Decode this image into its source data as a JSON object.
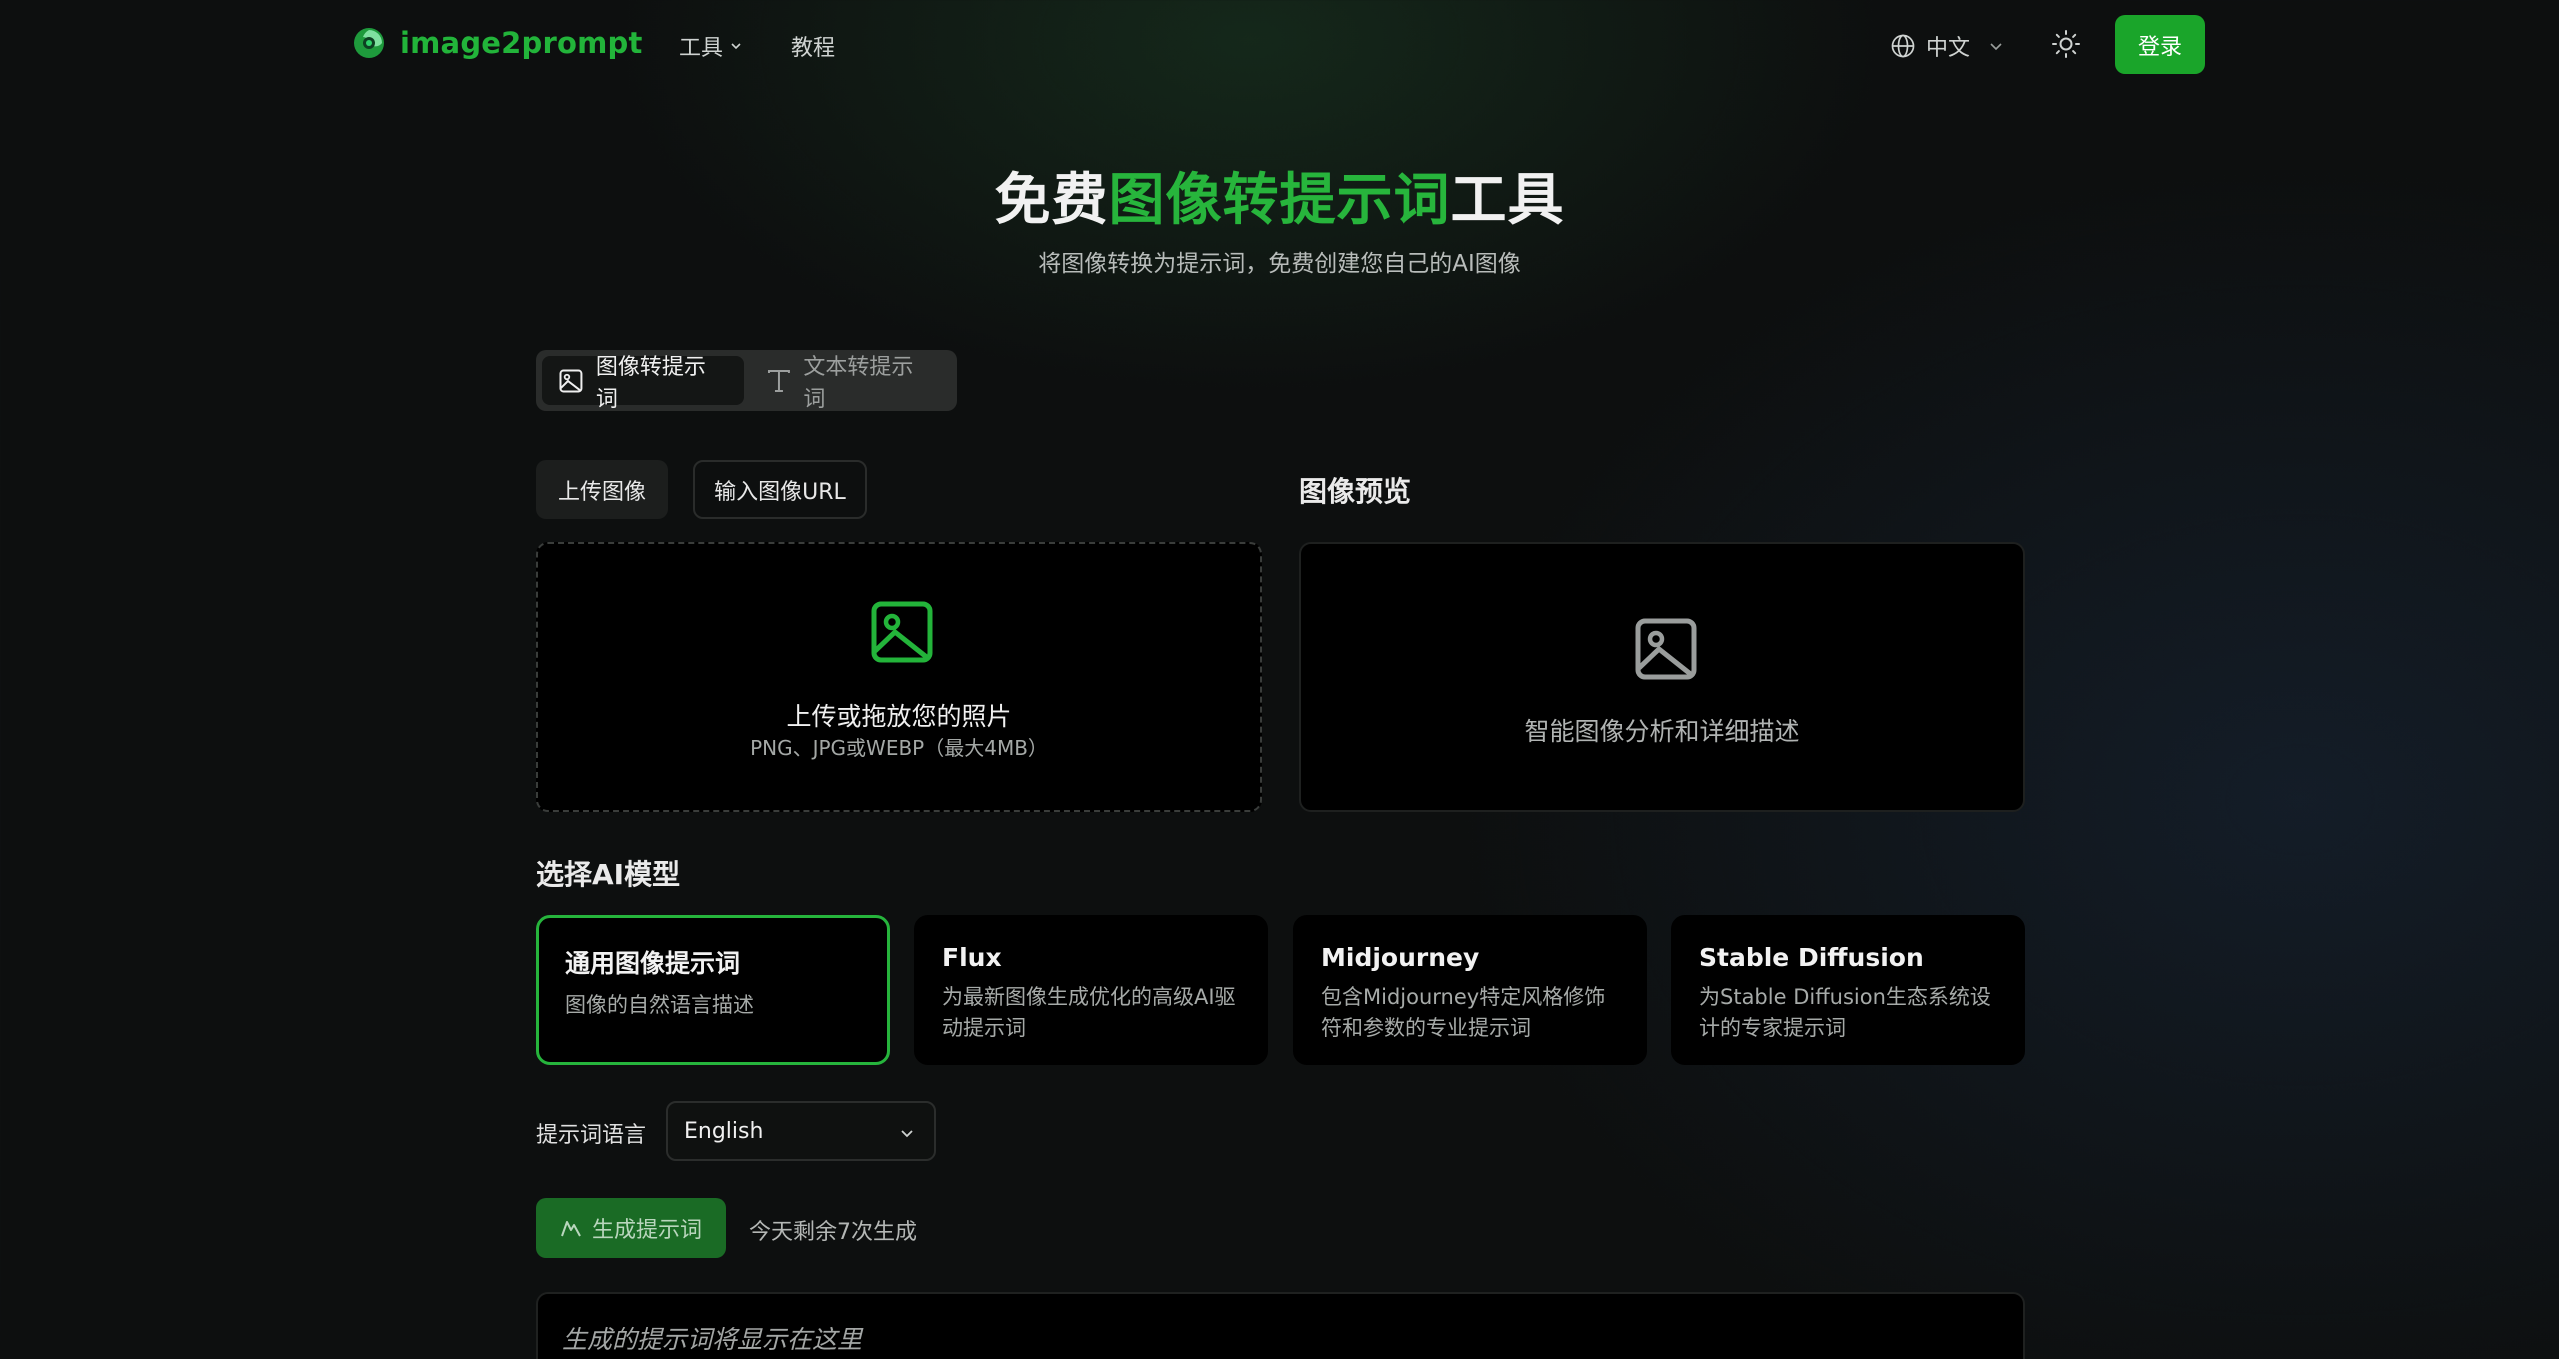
{
  "header": {
    "brand": "image2prompt",
    "nav": [
      {
        "label": "工具",
        "has_dropdown": true
      },
      {
        "label": "教程",
        "has_dropdown": false
      }
    ],
    "language": "中文",
    "theme_icon": "sun-icon",
    "login_label": "登录"
  },
  "hero": {
    "title_prefix": "免费",
    "title_accent": "图像转提示词",
    "title_suffix": "工具",
    "subtitle": "将图像转换为提示词，免费创建您自己的AI图像"
  },
  "mode_tabs": [
    {
      "label": "图像转提示词",
      "icon": "image-icon",
      "active": true
    },
    {
      "label": "文本转提示词",
      "icon": "text-icon",
      "active": false
    }
  ],
  "upload": {
    "tab_upload": "上传图像",
    "tab_url": "输入图像URL",
    "drop_title": "上传或拖放您的照片",
    "drop_hint": "PNG、JPG或WEBP（最大4MB）"
  },
  "preview": {
    "heading": "图像预览",
    "placeholder": "智能图像分析和详细描述"
  },
  "models": {
    "heading": "选择AI模型",
    "items": [
      {
        "name": "通用图像提示词",
        "desc": "图像的自然语言描述",
        "selected": true
      },
      {
        "name": "Flux",
        "desc": "为最新图像生成优化的高级AI驱动提示词",
        "selected": false
      },
      {
        "name": "Midjourney",
        "desc": "包含Midjourney特定风格修饰符和参数的专业提示词",
        "selected": false
      },
      {
        "name": "Stable Diffusion",
        "desc": "为Stable Diffusion生态系统设计的专家提示词",
        "selected": false
      }
    ]
  },
  "prompt_language": {
    "label": "提示词语言",
    "value": "English"
  },
  "generate": {
    "label": "生成提示词",
    "remaining": "今天剩余7次生成"
  },
  "output": {
    "placeholder": "生成的提示词将显示在这里"
  },
  "colors": {
    "accent": "#27b53c",
    "login_bg": "#1aa52a",
    "generate_bg": "#1a6b25"
  }
}
